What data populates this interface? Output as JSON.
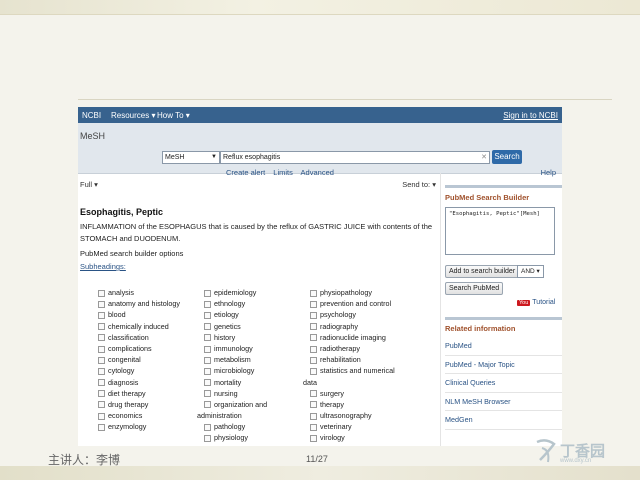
{
  "slide": {
    "footer_presenter": "主讲人：李博",
    "page_number": "11/27",
    "watermark_text": "丁香园",
    "watermark_url": "www.dxy.cn"
  },
  "ncbi_bar": {
    "logo": "NCBI",
    "resources": "Resources ▾",
    "how_to": "How To ▾",
    "sign_in": "Sign in to NCBI"
  },
  "search": {
    "db_title": "MeSH",
    "db_selected": "MeSH",
    "query": "Reflux esophagitis",
    "clear_icon": "✕",
    "button": "Search",
    "links": [
      "Create alert",
      "Limits",
      "Advanced"
    ],
    "help": "Help"
  },
  "record": {
    "display_menu": "Full ▾",
    "send_to": "Send to: ▾",
    "term_title": "Esophagitis, Peptic",
    "definition": "INFLAMMATION of the ESOPHAGUS that is caused by the reflux of GASTRIC JUICE with contents of the STOMACH and DUODENUM.",
    "builder_options": "PubMed search builder options",
    "subheadings_label": "Subheadings:",
    "subheadings": {
      "col1": [
        "analysis",
        "anatomy and histology",
        "blood",
        "chemically induced",
        "classification",
        "complications",
        "congenital",
        "cytology",
        "diagnosis",
        "diet therapy",
        "drug therapy",
        "economics",
        "enzymology"
      ],
      "col2": [
        "epidemiology",
        "ethnology",
        "etiology",
        "genetics",
        "history",
        "immunology",
        "metabolism",
        "microbiology",
        "mortality",
        "nursing",
        "organization and",
        "administration",
        "pathology",
        "physiology"
      ],
      "col3": [
        "physiopathology",
        "prevention and control",
        "psychology",
        "radiography",
        "radionuclide imaging",
        "radiotherapy",
        "rehabilitation",
        "statistics and numerical",
        "data",
        "surgery",
        "therapy",
        "ultrasonography",
        "veterinary",
        "virology"
      ]
    }
  },
  "builder": {
    "title": "PubMed Search Builder",
    "query_text": "\"Esophagitis, Peptic\"[Mesh]",
    "add_button": "Add to search builder",
    "operator": "AND ▾",
    "search_button": "Search PubMed",
    "youtube_badge": "You",
    "tutorial": "Tutorial"
  },
  "related": {
    "title": "Related information",
    "items": [
      "PubMed",
      "PubMed - Major Topic",
      "Clinical Queries",
      "NLM MeSH Browser",
      "MedGen"
    ]
  }
}
